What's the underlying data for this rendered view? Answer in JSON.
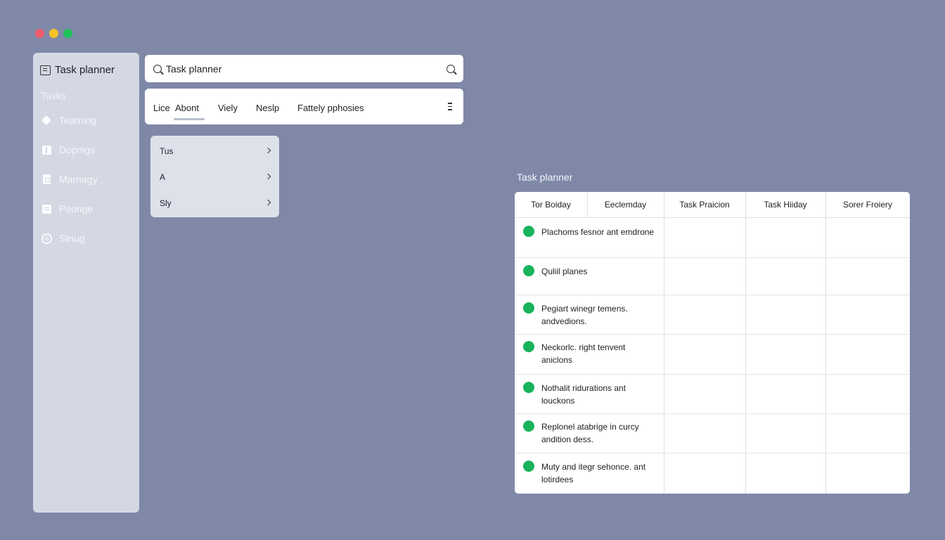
{
  "window_controls": {
    "close_color": "#ee5f6e",
    "minimize_color": "#f5c226",
    "zoom_color": "#20c15a"
  },
  "sidebar": {
    "title": "Task planner",
    "title_icon": "calendar-icon",
    "section_label": "Tasks",
    "items": [
      {
        "label": "Teaming",
        "icon": "diamond-icon"
      },
      {
        "label": "Dopnigs",
        "icon": "panel-icon"
      },
      {
        "label": "Marnagy",
        "icon": "document-icon"
      },
      {
        "label": "Poonge",
        "icon": "list-icon"
      },
      {
        "label": "Striug",
        "icon": "settings-circle-icon"
      }
    ]
  },
  "search": {
    "placeholder": "Task planner",
    "value": ""
  },
  "tabs": [
    {
      "label": "Lice"
    },
    {
      "label": "Abont",
      "active": true
    },
    {
      "label": "Viely"
    },
    {
      "label": "Neslp"
    },
    {
      "label": "Fattely pphosies"
    }
  ],
  "dropdown": {
    "items": [
      {
        "label": "Tus"
      },
      {
        "label": "A"
      },
      {
        "label": "Sly"
      }
    ]
  },
  "table": {
    "title": "Task planner",
    "columns": [
      "Tor Boiday",
      "Eeclemday",
      "Task Praicion",
      "Task Hiiday",
      "Sorer Froiery"
    ],
    "rows": [
      {
        "status_color": "#19b35c",
        "text": "Plachoms fesnor ant emdrone"
      },
      {
        "status_color": "#19b35c",
        "text": "Quliil planes"
      },
      {
        "status_color": "#19b35c",
        "text": "Pegiart winegr temens. andvedions."
      },
      {
        "status_color": "#19b35c",
        "text": "Neckorlc. right tenvent aniclons"
      },
      {
        "status_color": "#19b35c",
        "text": "Nothalit ridurations ant louckons"
      },
      {
        "status_color": "#19b35c",
        "text": "Replonel atabrige in curcy andition dess."
      },
      {
        "status_color": "#19b35c",
        "text": "Muty and itegr sehonce. ant lotirdees"
      }
    ]
  }
}
